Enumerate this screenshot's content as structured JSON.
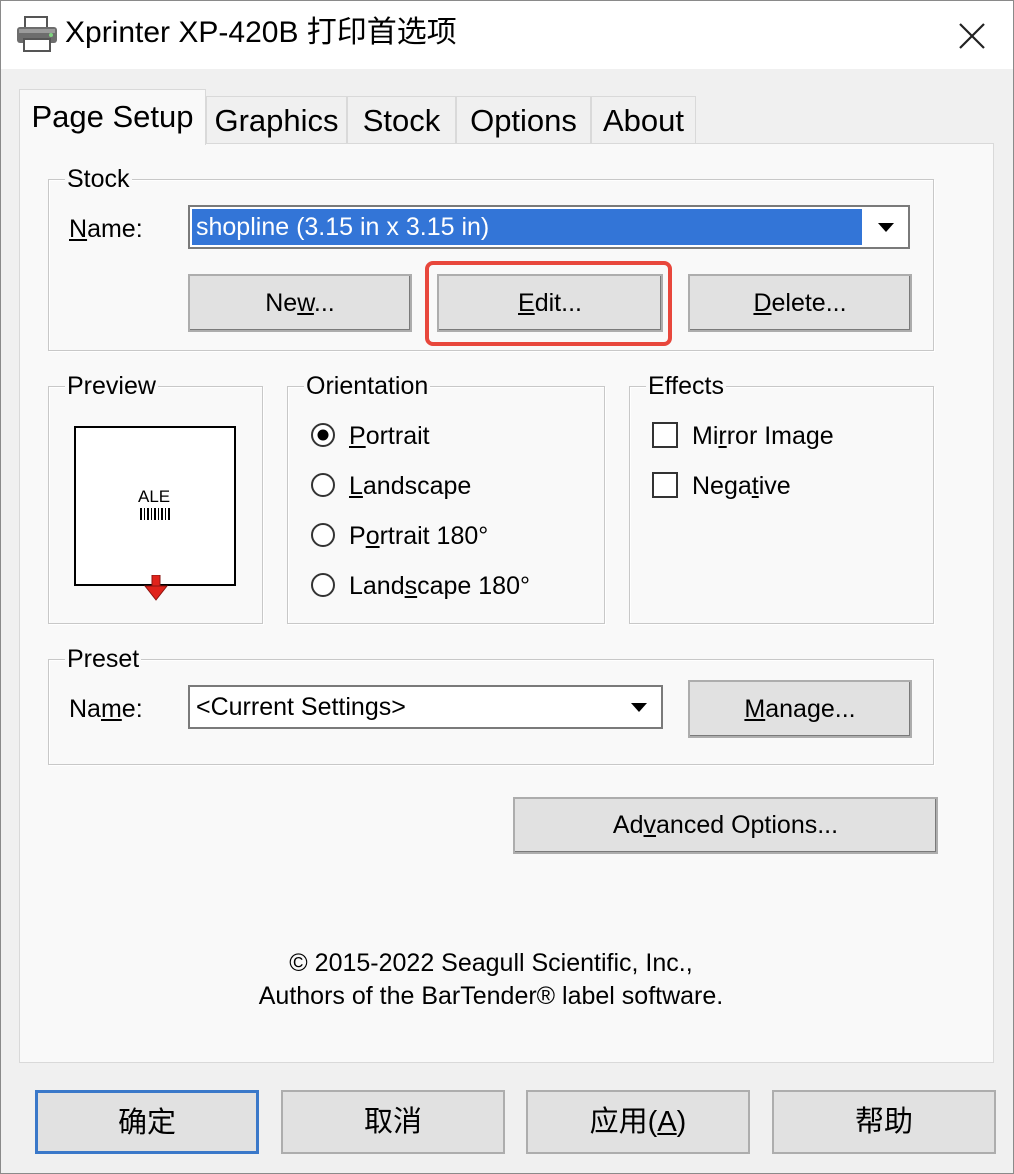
{
  "window": {
    "title": "Xprinter XP-420B 打印首选项"
  },
  "tabs": [
    {
      "label": "Page Setup",
      "active": true
    },
    {
      "label": "Graphics",
      "active": false
    },
    {
      "label": "Stock",
      "active": false
    },
    {
      "label": "Options",
      "active": false
    },
    {
      "label": "About",
      "active": false
    }
  ],
  "stock": {
    "group_label": "Stock",
    "name_label": "Name:",
    "name_value": "shopline (3.15 in x 3.15 in)",
    "new_button": "New...",
    "edit_button": "Edit...",
    "delete_button": "Delete..."
  },
  "preview": {
    "group_label": "Preview",
    "sample_text": "ALE"
  },
  "orientation": {
    "group_label": "Orientation",
    "options": [
      "Portrait",
      "Landscape",
      "Portrait 180°",
      "Landscape 180°"
    ],
    "selected": "Portrait"
  },
  "effects": {
    "group_label": "Effects",
    "mirror_image": "Mirror Image",
    "negative": "Negative",
    "mirror_checked": false,
    "negative_checked": false
  },
  "preset": {
    "group_label": "Preset",
    "name_label": "Name:",
    "name_value": "<Current Settings>",
    "manage_button": "Manage..."
  },
  "advanced_button": "Advanced Options...",
  "copyright": {
    "line1": "© 2015-2022 Seagull Scientific, Inc.,",
    "line2": "Authors of the BarTender® label software."
  },
  "footer_buttons": {
    "ok": "确定",
    "cancel": "取消",
    "apply": "应用(A)",
    "help": "帮助"
  },
  "colors": {
    "selection": "#3375d7",
    "highlight_box": "#e8473c",
    "default_button_border": "#3a78c9"
  }
}
